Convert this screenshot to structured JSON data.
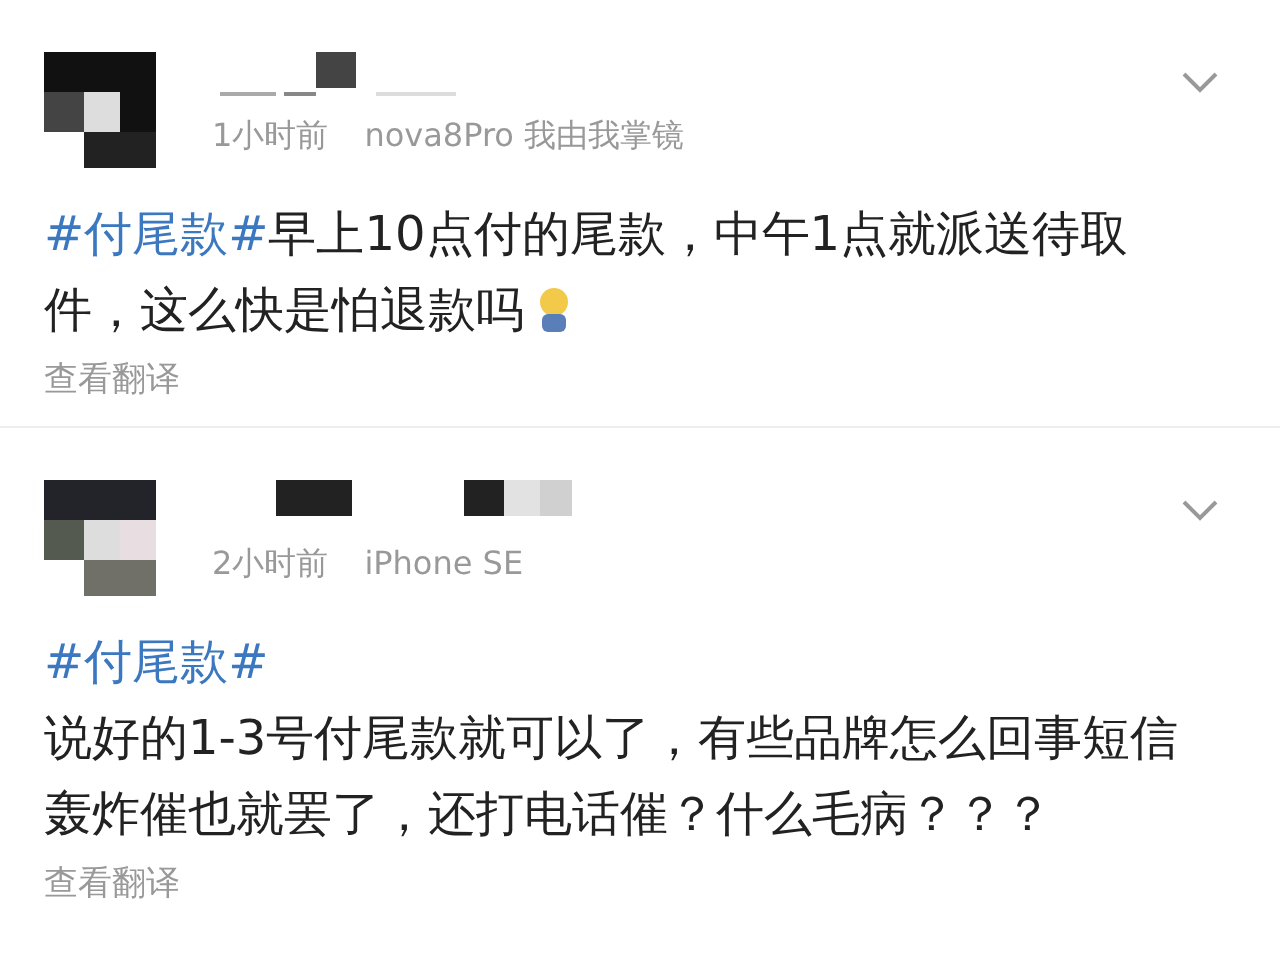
{
  "posts": [
    {
      "time": "1小时前",
      "device": "nova8Pro 我由我掌镜",
      "hashtag": "#付尾款#",
      "hashtag_own_line": false,
      "text": "早上10点付的尾款，中午1点就派送待取件，这么快是怕退款吗",
      "emoji": true,
      "translate": "查看翻译"
    },
    {
      "time": "2小时前",
      "device": "iPhone SE",
      "hashtag": "#付尾款#",
      "hashtag_own_line": true,
      "text": "说好的1-3号付尾款就可以了，有些品牌怎么回事短信轰炸催也就罢了，还打电话催？什么毛病？？？",
      "emoji": false,
      "translate": "查看翻译"
    }
  ]
}
